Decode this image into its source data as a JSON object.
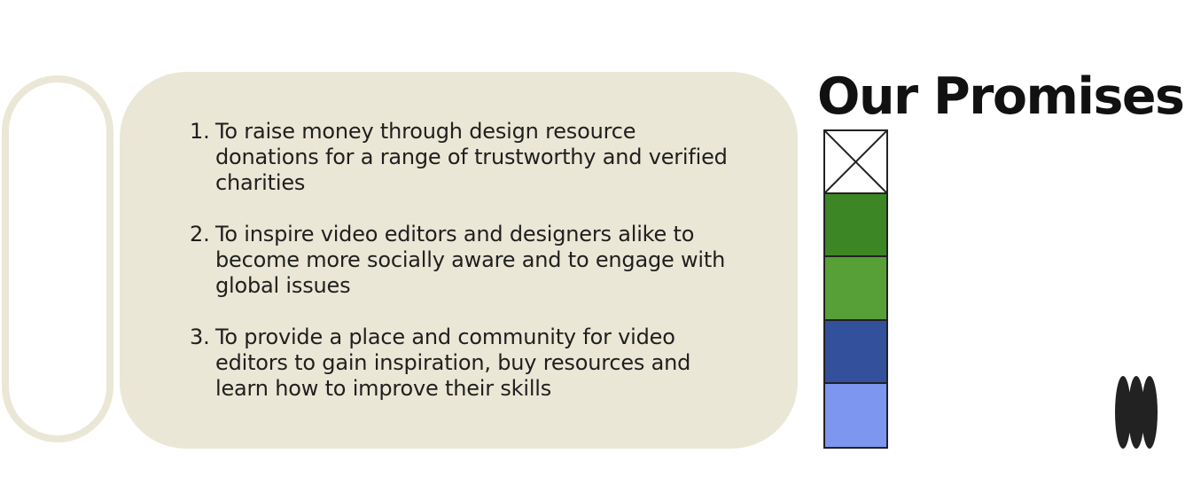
{
  "heading": "Our Promises",
  "promises": [
    {
      "number": "1.",
      "text": "To raise money through design resource donations for a range of trustworthy and verified charities"
    },
    {
      "number": "2.",
      "text": "To inspire video editors and designers alike to become more socially aware and to engage with global issues"
    },
    {
      "number": "3.",
      "text": "To provide a place and community for video editors to gain inspiration, buy resources and learn how to improve their skills"
    }
  ],
  "palette": {
    "card_background": "#ebe7d6",
    "swatches": [
      {
        "name": "empty",
        "color": "#ffffff"
      },
      {
        "name": "dark-green",
        "color": "#3d8625"
      },
      {
        "name": "green",
        "color": "#56a037"
      },
      {
        "name": "dark-blue",
        "color": "#33509c"
      },
      {
        "name": "light-blue",
        "color": "#7d96ef"
      }
    ]
  },
  "icons": {
    "logo": "triple-ellipse-logo-icon",
    "placeholder": "crossed-box-icon"
  }
}
